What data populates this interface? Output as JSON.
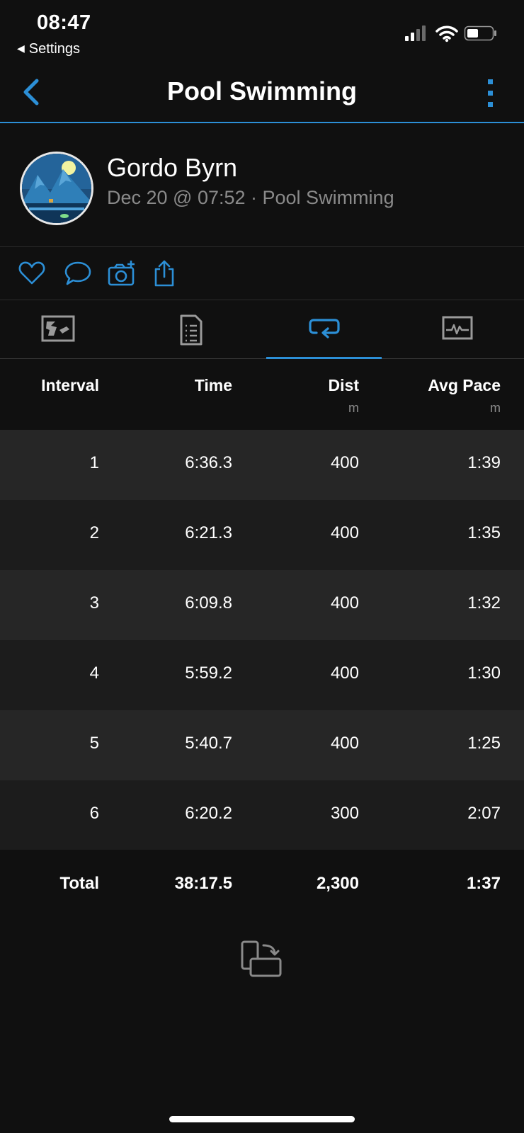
{
  "status_bar": {
    "time": "08:47",
    "back_app": "Settings"
  },
  "nav": {
    "title": "Pool Swimming",
    "back_icon": "chevron-left-icon",
    "more_icon": "vertical-dots-icon"
  },
  "profile": {
    "name": "Gordo Byrn",
    "subtitle": "Dec 20 @ 07:52 · Pool Swimming"
  },
  "actions": [
    {
      "name": "like",
      "icon": "heart-icon"
    },
    {
      "name": "comment",
      "icon": "comment-icon"
    },
    {
      "name": "add-photo",
      "icon": "camera-plus-icon"
    },
    {
      "name": "share",
      "icon": "share-icon"
    }
  ],
  "tabs": [
    {
      "name": "overview",
      "icon": "map-overview-icon",
      "active": false
    },
    {
      "name": "stats",
      "icon": "document-list-icon",
      "active": false
    },
    {
      "name": "laps",
      "icon": "loop-arrows-icon",
      "active": true
    },
    {
      "name": "charts",
      "icon": "activity-graph-icon",
      "active": false
    }
  ],
  "table": {
    "headers": {
      "interval": "Interval",
      "time": "Time",
      "dist": "Dist",
      "dist_unit": "m",
      "pace": "Avg Pace",
      "pace_unit": "m"
    },
    "rows": [
      {
        "interval": "1",
        "time": "6:36.3",
        "dist": "400",
        "pace": "1:39"
      },
      {
        "interval": "2",
        "time": "6:21.3",
        "dist": "400",
        "pace": "1:35"
      },
      {
        "interval": "3",
        "time": "6:09.8",
        "dist": "400",
        "pace": "1:32"
      },
      {
        "interval": "4",
        "time": "5:59.2",
        "dist": "400",
        "pace": "1:30"
      },
      {
        "interval": "5",
        "time": "5:40.7",
        "dist": "400",
        "pace": "1:25"
      },
      {
        "interval": "6",
        "time": "6:20.2",
        "dist": "300",
        "pace": "2:07"
      }
    ],
    "total": {
      "label": "Total",
      "time": "38:17.5",
      "dist": "2,300",
      "pace": "1:37"
    }
  },
  "rotate_icon": "rotate-device-icon",
  "colors": {
    "accent": "#2c8fd6",
    "background": "#101010",
    "row_light": "#262626",
    "row_dark": "#1c1c1c",
    "muted_text": "#8a8a8a"
  }
}
